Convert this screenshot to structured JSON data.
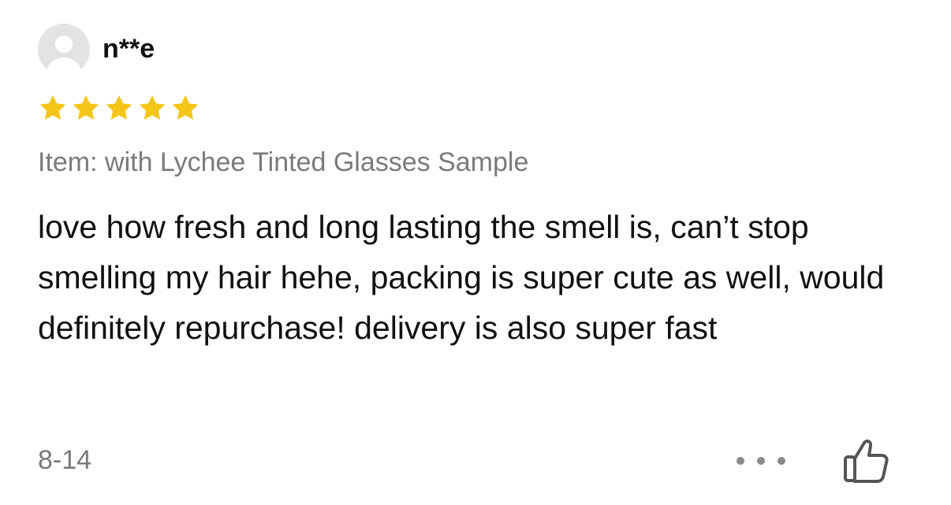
{
  "review": {
    "username": "n**e",
    "rating": 5,
    "rating_max": 5,
    "star_color": "#F5C518",
    "item": "Item: with Lychee Tinted Glasses Sample",
    "text": "love how fresh and long lasting the smell is, can’t stop smelling my hair hehe, packing is super cute as well, would definitely repurchase! delivery is also super fast",
    "date": "8-14"
  },
  "icons": {
    "avatar": "default-user-icon",
    "star": "star-icon",
    "more": "more-horizontal-icon",
    "like": "thumbs-up-icon"
  }
}
